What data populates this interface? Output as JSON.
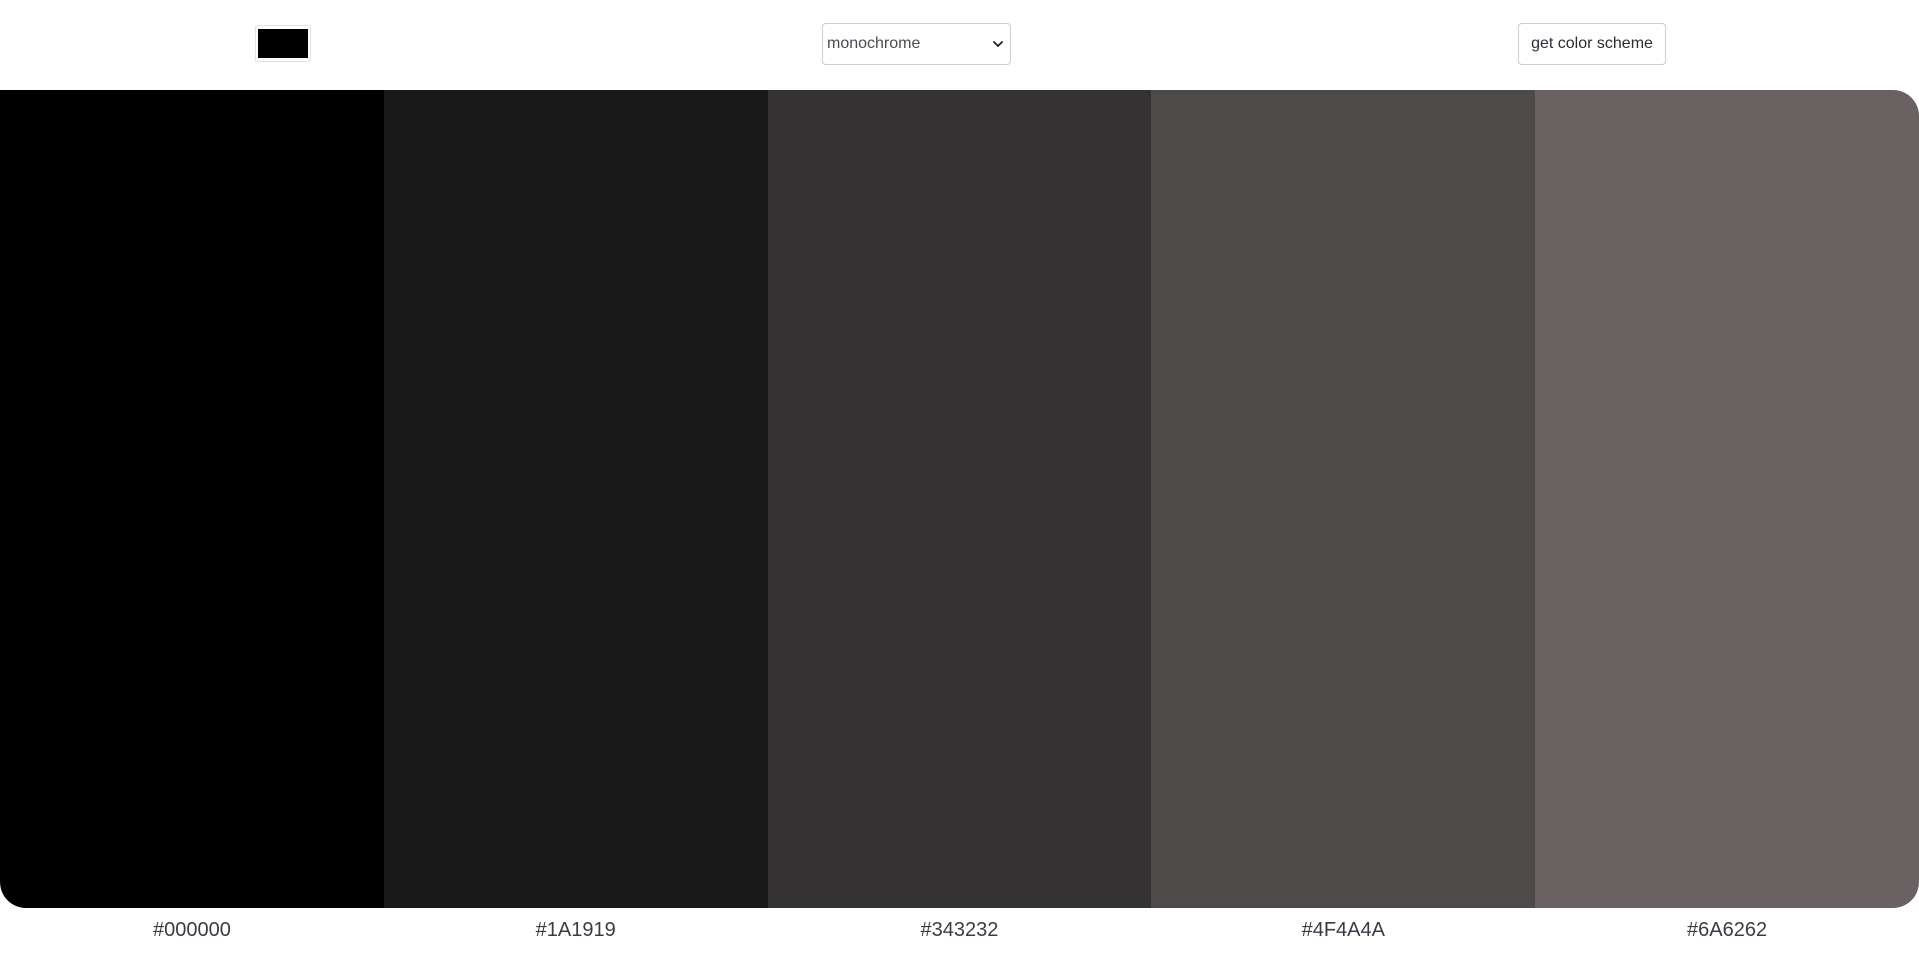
{
  "toolbar": {
    "seed_color": "#000000",
    "mode": {
      "selected": "monochrome"
    },
    "button_label": "get color scheme"
  },
  "palette": {
    "colors": [
      {
        "hex": "#000000",
        "label": "#000000"
      },
      {
        "hex": "#1A1919",
        "label": "#1A1919"
      },
      {
        "hex": "#343232",
        "label": "#343232"
      },
      {
        "hex": "#4F4A4A",
        "label": "#4F4A4A"
      },
      {
        "hex": "#6A6262",
        "label": "#6A6262"
      }
    ]
  },
  "icons": {
    "select_arrow": "chevron-down-icon"
  }
}
